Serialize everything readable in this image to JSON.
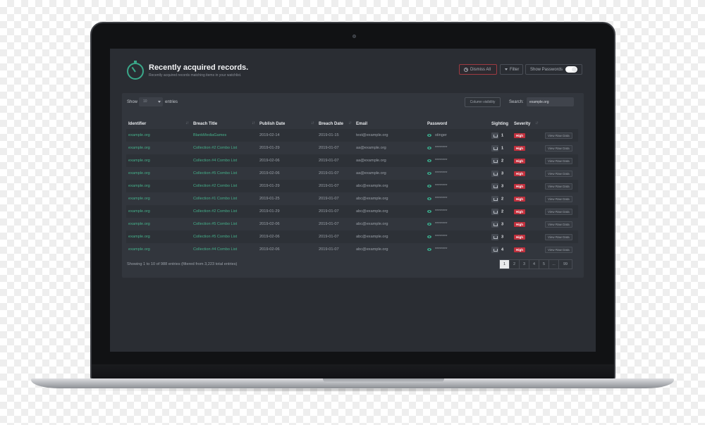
{
  "header": {
    "title": "Recently acquired records.",
    "subtitle": "Recently acquired records matching items in your watchlist.",
    "dismiss_label": "Dismiss All",
    "filter_label": "Filter",
    "show_passwords_label": "Show Passwords"
  },
  "controls": {
    "show_label": "Show",
    "show_value": "10",
    "entries_label": "entries",
    "column_visibility_label": "Column visibility",
    "search_label": "Search:",
    "search_value": "example.org"
  },
  "table": {
    "columns": [
      "Identifier",
      "Breach Title",
      "Publish Date",
      "Breach Date",
      "Email",
      "Password",
      "Sighting",
      "Severity",
      ""
    ],
    "rows": [
      {
        "identifier": "example.org",
        "breach_title": "BlankMediaGames",
        "publish_date": "2019-02-14",
        "breach_date": "2019-01-15",
        "email": "test@example.org",
        "password": "stinger",
        "sighting": "1",
        "severity": "High",
        "action": "View Raw Data"
      },
      {
        "identifier": "example.org",
        "breach_title": "Collection #2 Combo List",
        "publish_date": "2019-01-29",
        "breach_date": "2019-01-07",
        "email": "aa@example.org",
        "password": "********",
        "sighting": "1",
        "severity": "High",
        "action": "View Raw Data"
      },
      {
        "identifier": "example.org",
        "breach_title": "Collection #4 Combo List",
        "publish_date": "2019-02-06",
        "breach_date": "2019-01-07",
        "email": "aa@example.org",
        "password": "********",
        "sighting": "2",
        "severity": "High",
        "action": "View Raw Data"
      },
      {
        "identifier": "example.org",
        "breach_title": "Collection #5 Combo List",
        "publish_date": "2019-02-06",
        "breach_date": "2019-01-07",
        "email": "aa@example.org",
        "password": "********",
        "sighting": "3",
        "severity": "High",
        "action": "View Raw Data"
      },
      {
        "identifier": "example.org",
        "breach_title": "Collection #2 Combo List",
        "publish_date": "2019-01-29",
        "breach_date": "2019-01-07",
        "email": "abc@example.org",
        "password": "********",
        "sighting": "3",
        "severity": "High",
        "action": "View Raw Data"
      },
      {
        "identifier": "example.org",
        "breach_title": "Collection #1 Combo List",
        "publish_date": "2019-01-25",
        "breach_date": "2019-01-07",
        "email": "abc@example.org",
        "password": "********",
        "sighting": "2",
        "severity": "High",
        "action": "View Raw Data"
      },
      {
        "identifier": "example.org",
        "breach_title": "Collection #2 Combo List",
        "publish_date": "2019-01-29",
        "breach_date": "2019-01-07",
        "email": "abc@example.org",
        "password": "********",
        "sighting": "2",
        "severity": "High",
        "action": "View Raw Data"
      },
      {
        "identifier": "example.org",
        "breach_title": "Collection #5 Combo List",
        "publish_date": "2019-02-06",
        "breach_date": "2019-01-07",
        "email": "abc@example.org",
        "password": "********",
        "sighting": "3",
        "severity": "High",
        "action": "View Raw Data"
      },
      {
        "identifier": "example.org",
        "breach_title": "Collection #5 Combo List",
        "publish_date": "2019-02-06",
        "breach_date": "2019-01-07",
        "email": "abc@example.org",
        "password": "********",
        "sighting": "3",
        "severity": "High",
        "action": "View Raw Data"
      },
      {
        "identifier": "example.org",
        "breach_title": "Collection #4 Combo List",
        "publish_date": "2019-02-06",
        "breach_date": "2019-01-07",
        "email": "abc@example.org",
        "password": "********",
        "sighting": "4",
        "severity": "High",
        "action": "View Raw Data"
      }
    ]
  },
  "footer": {
    "info": "Showing 1 to 10 of 988 entries (filtered from 3,223 total entries)",
    "pages": [
      "1",
      "2",
      "3",
      "4",
      "5",
      "...",
      "99"
    ],
    "active_page": "1"
  },
  "colors": {
    "accent": "#45b08a",
    "severity_high": "#c1303d",
    "screen_bg": "#2a2d33",
    "panel_bg": "#32363d"
  },
  "icons": [
    "timer-logo-icon",
    "ban-icon",
    "caret-down-icon",
    "sort-icon",
    "eye-icon",
    "sighting-icon"
  ]
}
